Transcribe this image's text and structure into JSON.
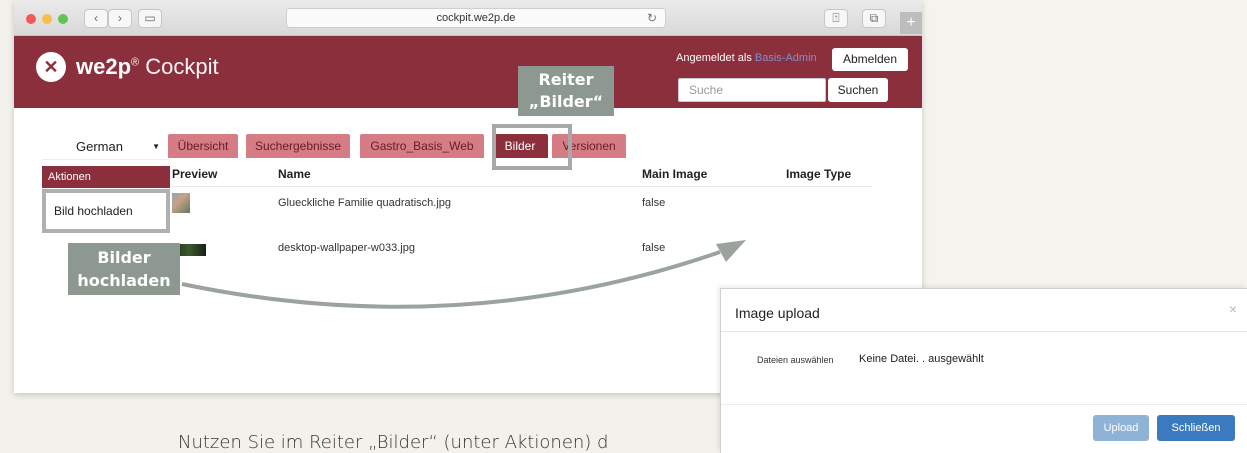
{
  "browser": {
    "url": "cockpit.we2p.de",
    "back_glyph": "‹",
    "forward_glyph": "›",
    "sidebar_glyph": "▭",
    "reload_glyph": "↻",
    "share_glyph": "⍐",
    "tabs_glyph": "⧉",
    "plus_glyph": "+"
  },
  "header": {
    "logo_glyph": "✕",
    "brand": "we2p",
    "brand_reg": "®",
    "brand_suffix": " Cockpit",
    "login_prefix": "Angemeldet als ",
    "login_user": "Basis-Admin",
    "logout_label": "Abmelden",
    "search_placeholder": "Suche",
    "search_label": "Suchen"
  },
  "callouts": {
    "reiter_line1": "Reiter",
    "reiter_line2": "„Bilder“",
    "upload_line1": "Bilder",
    "upload_line2": "hochladen"
  },
  "sidebar": {
    "language": "German",
    "caret": "▼",
    "actions_title": "Aktionen",
    "actions_item": "Bild hochladen"
  },
  "tabs": [
    {
      "label": "Übersicht"
    },
    {
      "label": "Suchergebnisse"
    },
    {
      "label": "Gastro_Basis_Web"
    },
    {
      "label": "Bilder"
    },
    {
      "label": "Versionen"
    }
  ],
  "table": {
    "columns": [
      "Preview",
      "Name",
      "Main Image",
      "Image Type"
    ],
    "rows": [
      {
        "name": "Glueckliche Familie quadratisch.jpg",
        "main_image": "false",
        "image_type": ""
      },
      {
        "name": "desktop-wallpaper-w033.jpg",
        "main_image": "false",
        "image_type": ""
      }
    ]
  },
  "dialog": {
    "title": "Image upload",
    "close_glyph": "×",
    "file_label": "Dateien auswählen",
    "file_value": "Keine Datei. . ausgewählt",
    "upload_label": "Upload",
    "close_label": "Schließen"
  },
  "caption": "Nutzen Sie im Reiter „Bilder“ (unter Aktionen) d",
  "colors": {
    "brand": "#8c2f3d",
    "tab_inactive": "#d57c85",
    "callout": "#8d9990",
    "primary_button": "#3c7ac0"
  }
}
